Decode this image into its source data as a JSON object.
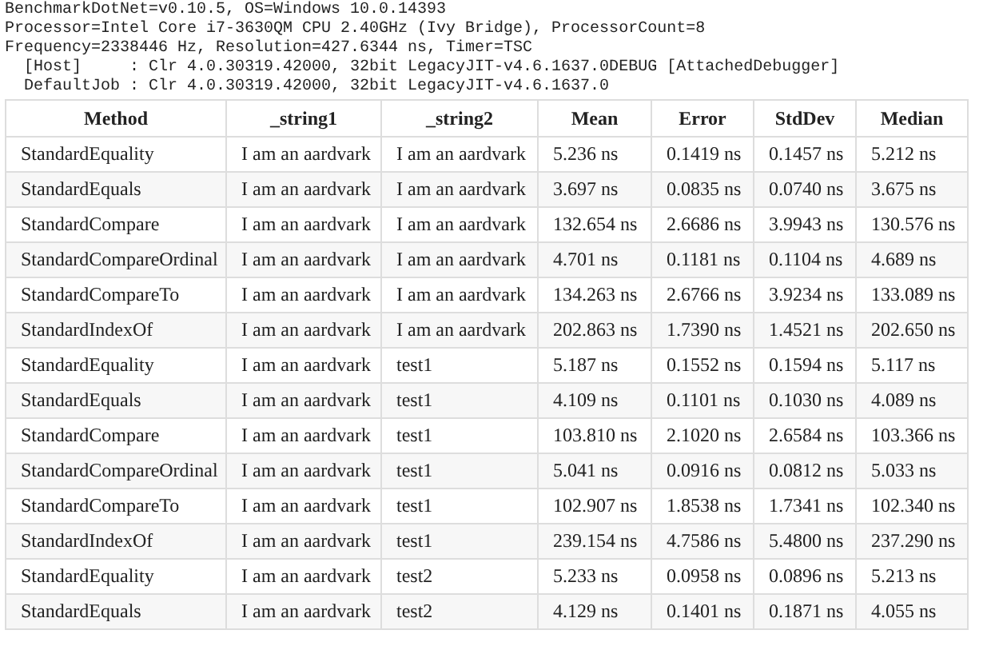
{
  "environment_lines": [
    "BenchmarkDotNet=v0.10.5, OS=Windows 10.0.14393",
    "Processor=Intel Core i7-3630QM CPU 2.40GHz (Ivy Bridge), ProcessorCount=8",
    "Frequency=2338446 Hz, Resolution=427.6344 ns, Timer=TSC",
    "  [Host]     : Clr 4.0.30319.42000, 32bit LegacyJIT-v4.6.1637.0DEBUG [AttachedDebugger]",
    "  DefaultJob : Clr 4.0.30319.42000, 32bit LegacyJIT-v4.6.1637.0"
  ],
  "table": {
    "columns": [
      "Method",
      "_string1",
      "_string2",
      "Mean",
      "Error",
      "StdDev",
      "Median"
    ],
    "rows": [
      [
        "StandardEquality",
        "I am an aardvark",
        "I am an aardvark",
        "5.236 ns",
        "0.1419 ns",
        "0.1457 ns",
        "5.212 ns"
      ],
      [
        "StandardEquals",
        "I am an aardvark",
        "I am an aardvark",
        "3.697 ns",
        "0.0835 ns",
        "0.0740 ns",
        "3.675 ns"
      ],
      [
        "StandardCompare",
        "I am an aardvark",
        "I am an aardvark",
        "132.654 ns",
        "2.6686 ns",
        "3.9943 ns",
        "130.576 ns"
      ],
      [
        "StandardCompareOrdinal",
        "I am an aardvark",
        "I am an aardvark",
        "4.701 ns",
        "0.1181 ns",
        "0.1104 ns",
        "4.689 ns"
      ],
      [
        "StandardCompareTo",
        "I am an aardvark",
        "I am an aardvark",
        "134.263 ns",
        "2.6766 ns",
        "3.9234 ns",
        "133.089 ns"
      ],
      [
        "StandardIndexOf",
        "I am an aardvark",
        "I am an aardvark",
        "202.863 ns",
        "1.7390 ns",
        "1.4521 ns",
        "202.650 ns"
      ],
      [
        "StandardEquality",
        "I am an aardvark",
        "test1",
        "5.187 ns",
        "0.1552 ns",
        "0.1594 ns",
        "5.117 ns"
      ],
      [
        "StandardEquals",
        "I am an aardvark",
        "test1",
        "4.109 ns",
        "0.1101 ns",
        "0.1030 ns",
        "4.089 ns"
      ],
      [
        "StandardCompare",
        "I am an aardvark",
        "test1",
        "103.810 ns",
        "2.1020 ns",
        "2.6584 ns",
        "103.366 ns"
      ],
      [
        "StandardCompareOrdinal",
        "I am an aardvark",
        "test1",
        "5.041 ns",
        "0.0916 ns",
        "0.0812 ns",
        "5.033 ns"
      ],
      [
        "StandardCompareTo",
        "I am an aardvark",
        "test1",
        "102.907 ns",
        "1.8538 ns",
        "1.7341 ns",
        "102.340 ns"
      ],
      [
        "StandardIndexOf",
        "I am an aardvark",
        "test1",
        "239.154 ns",
        "4.7586 ns",
        "5.4800 ns",
        "237.290 ns"
      ],
      [
        "StandardEquality",
        "I am an aardvark",
        "test2",
        "5.233 ns",
        "0.0958 ns",
        "0.0896 ns",
        "5.213 ns"
      ],
      [
        "StandardEquals",
        "I am an aardvark",
        "test2",
        "4.129 ns",
        "0.1401 ns",
        "0.1871 ns",
        "4.055 ns"
      ]
    ]
  }
}
